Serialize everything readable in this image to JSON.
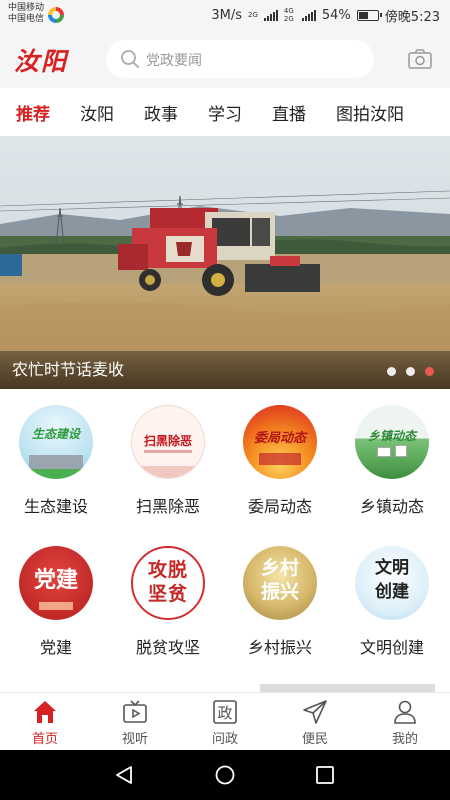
{
  "status_bar": {
    "carrier1": "中国移动",
    "carrier2": "中国电信",
    "speed": "3M/s",
    "net1": "2G",
    "net2": "4G 2G",
    "battery": "54%",
    "battery_level": 0.54,
    "time": "傍晚5:23"
  },
  "header": {
    "logo": "汝阳",
    "search_placeholder": "党政要闻"
  },
  "tabs": [
    "推荐",
    "汝阳",
    "政事",
    "学习",
    "直播",
    "图拍汝阳"
  ],
  "banner": {
    "caption": "农忙时节话麦收",
    "slide_count": 3,
    "active_slide": 3
  },
  "grid": [
    {
      "label": "生态建设",
      "art": "生态建设"
    },
    {
      "label": "扫黑除恶",
      "art": "扫黑除恶"
    },
    {
      "label": "委局动态",
      "art": "委局动态"
    },
    {
      "label": "乡镇动态",
      "art": "乡镇动态"
    },
    {
      "label": "党建",
      "art": "党建"
    },
    {
      "label": "脱贫攻坚",
      "art": "攻脱坚贫"
    },
    {
      "label": "乡村振兴",
      "art": "乡村振兴"
    },
    {
      "label": "文明创建",
      "art": "文明创建"
    }
  ],
  "bottom_nav": [
    {
      "label": "首页",
      "icon": "home-icon",
      "active": true
    },
    {
      "label": "视听",
      "icon": "tv-play-icon",
      "active": false
    },
    {
      "label": "问政",
      "icon": "zheng-icon",
      "active": false
    },
    {
      "label": "便民",
      "icon": "send-icon",
      "active": false
    },
    {
      "label": "我的",
      "icon": "user-icon",
      "active": false
    }
  ],
  "colors": {
    "brand_red": "#d62222",
    "header_bg": "#f5f5f5",
    "dot_active": "#e85a4f"
  }
}
